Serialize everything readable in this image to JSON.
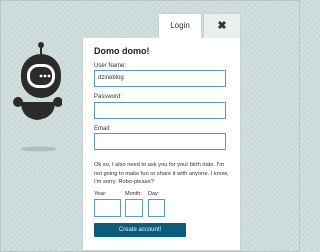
{
  "header": {
    "login_tab": "Login",
    "close_symbol": "✖"
  },
  "form": {
    "title": "Domo domo!",
    "username_label": "User Name:",
    "username_value": "dzineblog",
    "password_label": "Password:",
    "password_value": "",
    "email_label": "Email:",
    "email_value": "",
    "birthdate_note": "Ok so, I also need to ask you for your birth date. I'm not going to make fun or share it with anyone. I know, I'm sorry. Robo-please?",
    "year_label": "Year:",
    "month_label": "Month:",
    "day_label": "Day:",
    "year_value": "",
    "month_value": "",
    "day_value": "",
    "submit_label": "Create account!"
  },
  "mascot": {
    "icon": "robot-icon"
  },
  "colors": {
    "background": "#cfdcdc",
    "panel": "#ffffff",
    "input_border": "#5e9bb6",
    "button": "#0d5b7d",
    "robot_body": "#2b2b2b"
  }
}
